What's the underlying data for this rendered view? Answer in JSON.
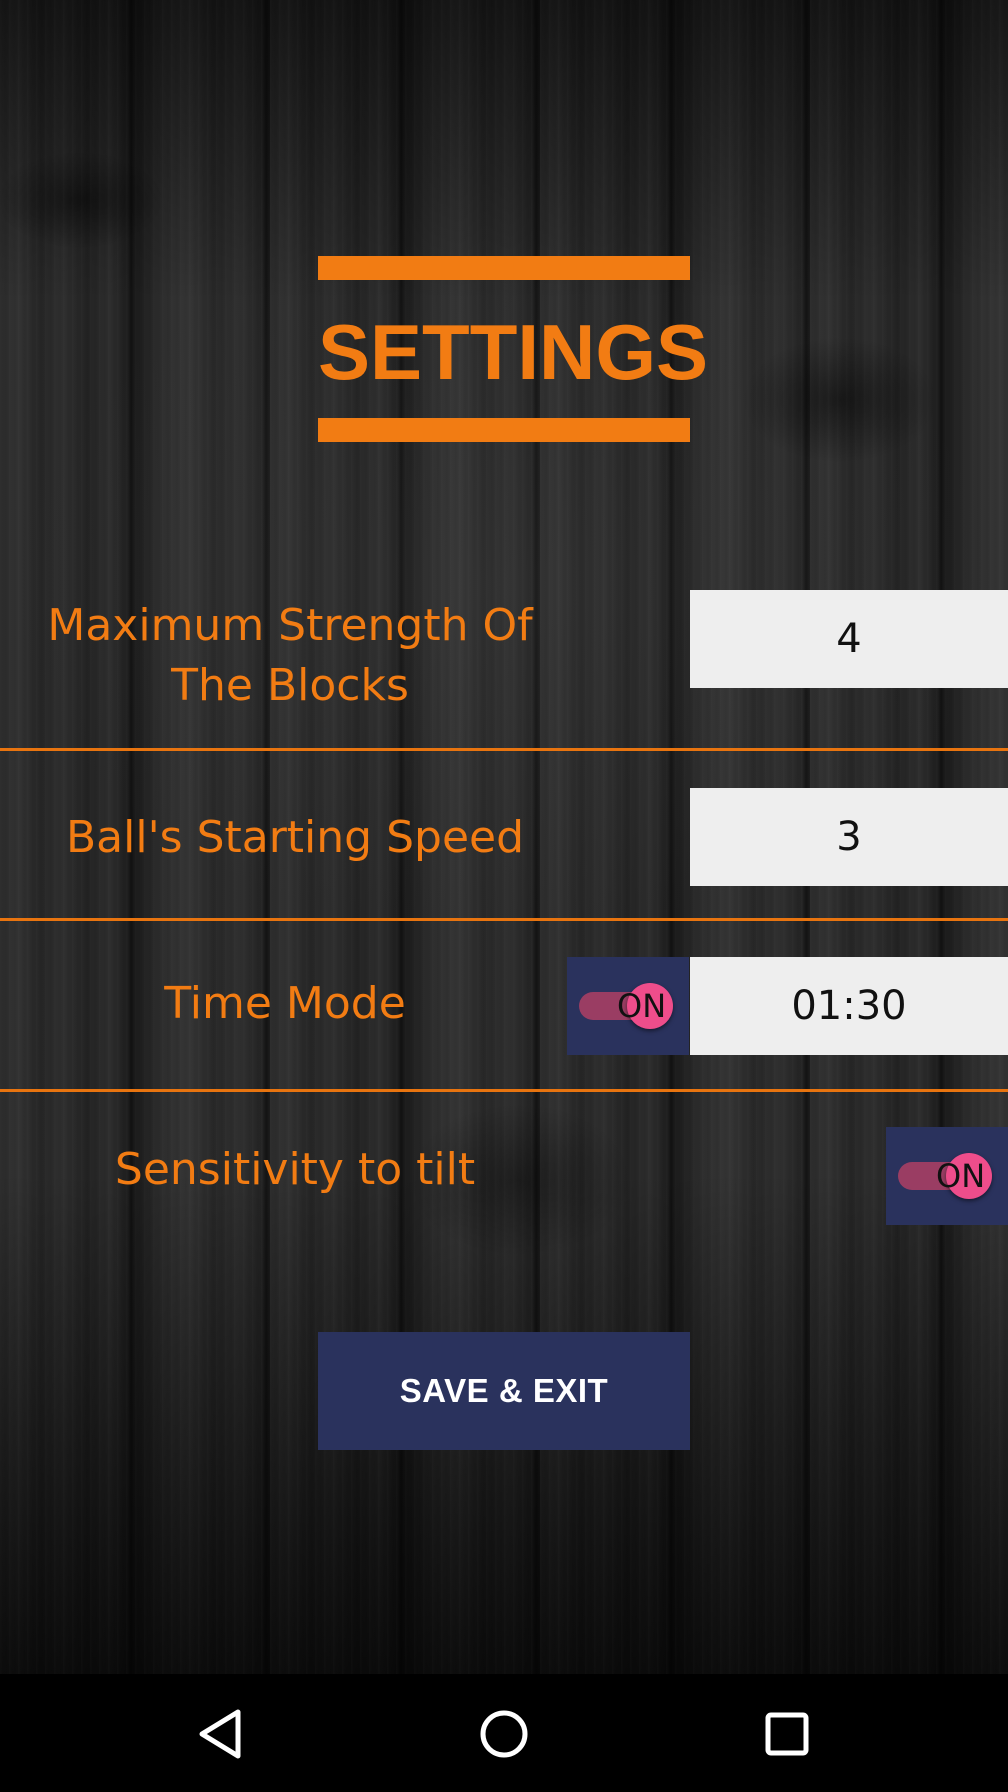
{
  "title": "SETTINGS",
  "rows": [
    {
      "label_line1": "Maximum Strength Of",
      "label_line2": "The Blocks",
      "value": "4"
    },
    {
      "label": "Ball's Starting Speed",
      "value": "3"
    },
    {
      "label": "Time Mode",
      "toggle": "ON",
      "value": "01:30"
    },
    {
      "label": "Sensitivity to tilt",
      "toggle": "ON"
    }
  ],
  "save_button": "SAVE & EXIT",
  "nav": {
    "back_icon": "back-triangle-icon",
    "home_icon": "home-circle-icon",
    "recents_icon": "recents-square-icon"
  },
  "colors": {
    "accent": "#f27c13",
    "button_bg": "#2a325d",
    "toggle_thumb": "#ee4d8b",
    "value_bg": "#eeeeee"
  }
}
